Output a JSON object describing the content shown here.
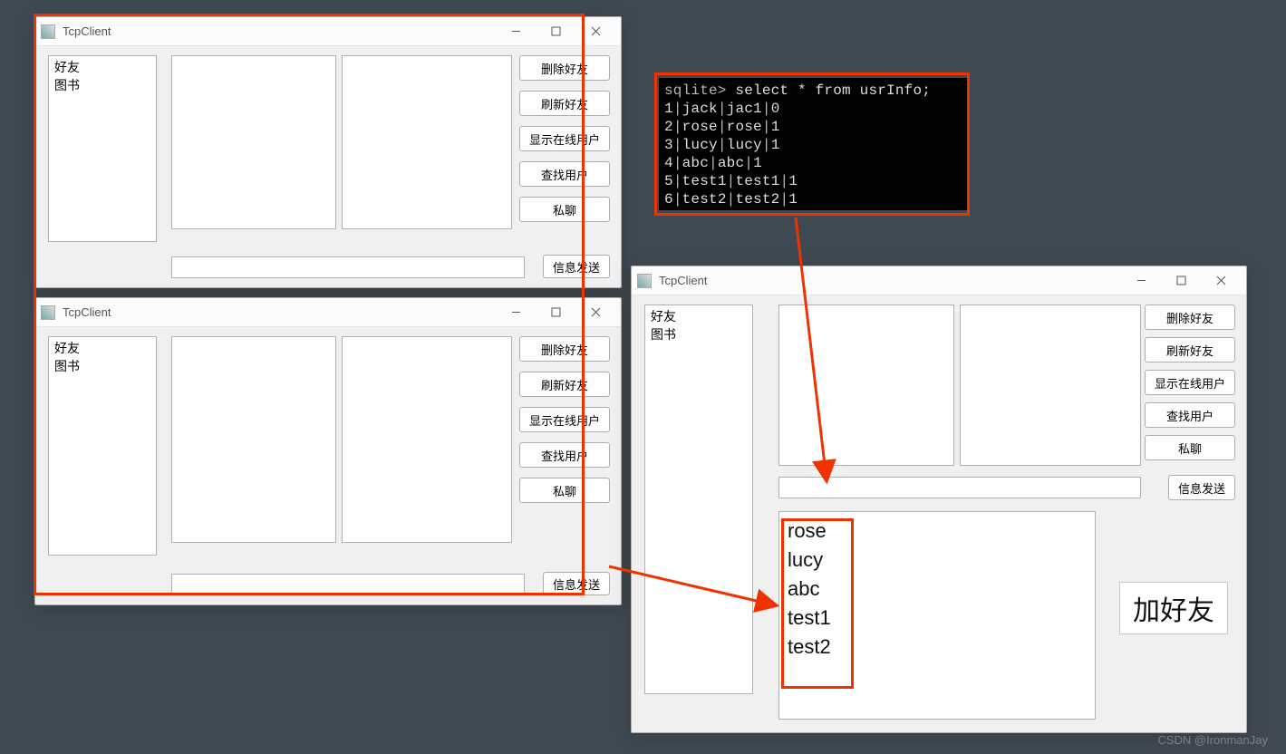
{
  "common": {
    "title": "TcpClient",
    "sidebar": {
      "friends": "好友",
      "books": "图书"
    },
    "buttons": {
      "delete": "删除好友",
      "refresh": "刷新好友",
      "online": "显示在线用户",
      "find": "查找用户",
      "private": "私聊",
      "send": "信息发送"
    }
  },
  "terminal": {
    "prompt": "sqlite> ",
    "query": "select * from usrInfo;",
    "rows": [
      {
        "id": "1",
        "name": "jack",
        "pwd": "jac1",
        "on": "0"
      },
      {
        "id": "2",
        "name": "rose",
        "pwd": "rose",
        "on": "1"
      },
      {
        "id": "3",
        "name": "lucy",
        "pwd": "lucy",
        "on": "1"
      },
      {
        "id": "4",
        "name": "abc",
        "pwd": "abc",
        "on": "1"
      },
      {
        "id": "5",
        "name": "test1",
        "pwd": "test1",
        "on": "1"
      },
      {
        "id": "6",
        "name": "test2",
        "pwd": "test2",
        "on": "1"
      }
    ]
  },
  "userlist": [
    "rose",
    "lucy",
    "abc",
    "test1",
    "test2"
  ],
  "addFriend": "加好友",
  "watermark": "CSDN @IronmanJay"
}
